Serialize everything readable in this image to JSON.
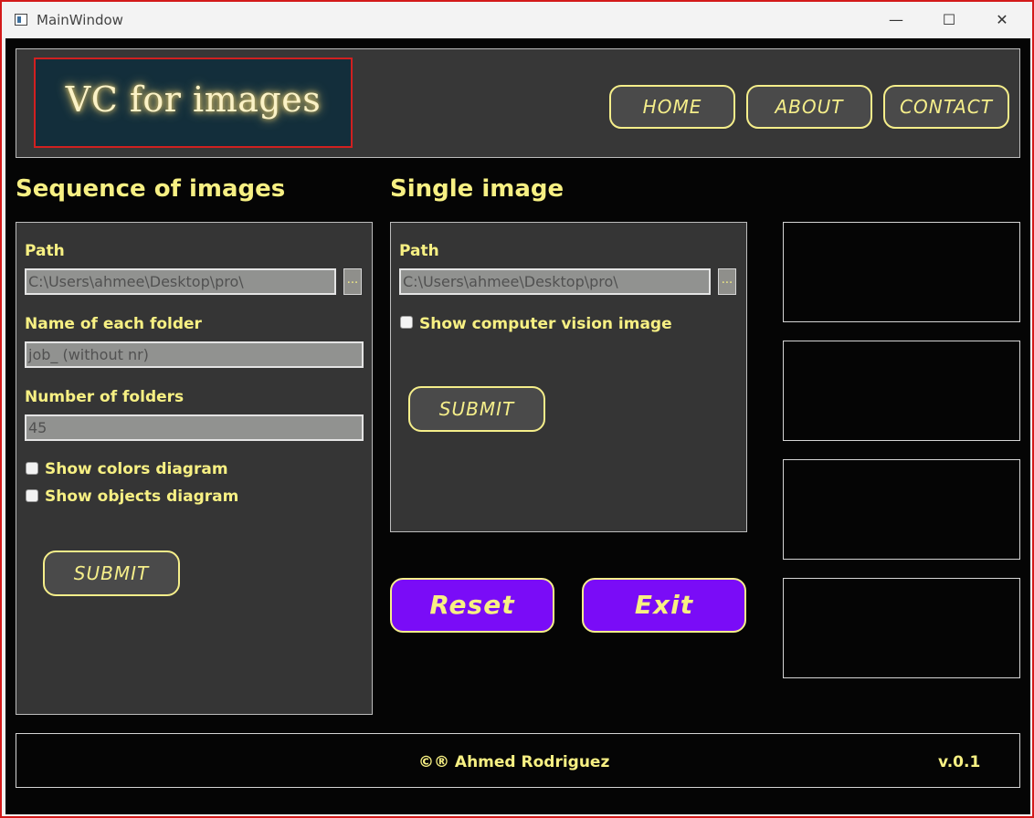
{
  "window": {
    "title": "MainWindow",
    "controls": {
      "minimize": "—",
      "maximize": "☐",
      "close": "✕"
    }
  },
  "header": {
    "logo_text": "VC for images",
    "nav": [
      "HOME",
      "ABOUT",
      "CONTACT"
    ]
  },
  "sequence": {
    "title": "Sequence of images",
    "path_label": "Path",
    "path_value": "C:\\Users\\ahmee\\Desktop\\pro\\",
    "browse": "...",
    "folder_name_label": "Name of each folder",
    "folder_name_placeholder": "job_   (without nr)",
    "folder_count_label": "Number of folders",
    "folder_count_value": "45",
    "show_colors_label": "Show colors diagram",
    "show_objects_label": "Show objects diagram",
    "submit": "SUBMIT"
  },
  "single": {
    "title": "Single image",
    "path_label": "Path",
    "path_value": "C:\\Users\\ahmee\\Desktop\\pro\\",
    "browse": "...",
    "show_cv_label": "Show computer vision image",
    "submit": "SUBMIT"
  },
  "actions": {
    "reset": "Reset",
    "exit": "Exit"
  },
  "footer": {
    "credit": "©® Ahmed Rodriguez",
    "version": "v.0.1"
  },
  "colors": {
    "accent": "#f7f083",
    "purple": "#7a0cf7",
    "panel": "#353535",
    "background": "#050505"
  }
}
